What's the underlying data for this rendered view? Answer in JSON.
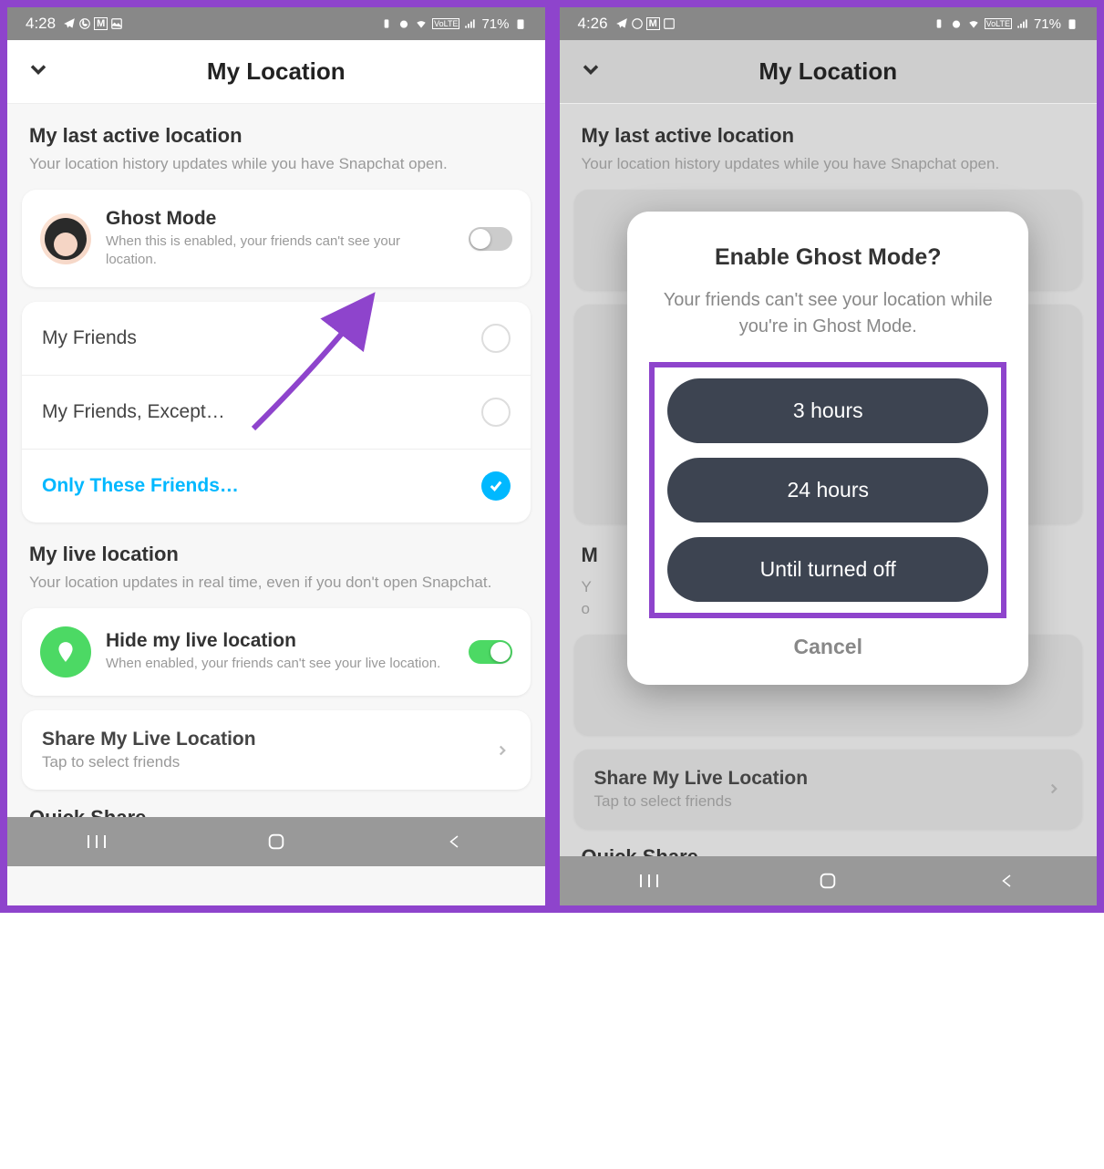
{
  "statusBar": {
    "timeLeft": "4:28",
    "timeRight": "4:26",
    "battery": "71%"
  },
  "header": {
    "title": "My Location"
  },
  "sections": {
    "lastActive": {
      "label": "My last active location",
      "desc": "Your location history updates while you have Snapchat open."
    },
    "ghostMode": {
      "title": "Ghost Mode",
      "subtitle": "When this is enabled, your friends can't see your location."
    },
    "visibility": {
      "opt1": "My Friends",
      "opt2": "My Friends, Except…",
      "opt3": "Only These Friends…"
    },
    "liveLocation": {
      "label": "My live location",
      "desc": "Your location updates in real time, even if you don't open Snapchat."
    },
    "hideLive": {
      "title": "Hide my live location",
      "subtitle": "When enabled, your friends can't see your live location."
    },
    "shareLive": {
      "title": "Share My Live Location",
      "subtitle": "Tap to select friends"
    },
    "quickShare": "Quick Share"
  },
  "modal": {
    "title": "Enable Ghost Mode?",
    "desc": "Your friends can't see your location while you're in Ghost Mode.",
    "btn1": "3 hours",
    "btn2": "24 hours",
    "btn3": "Until turned off",
    "cancel": "Cancel"
  }
}
